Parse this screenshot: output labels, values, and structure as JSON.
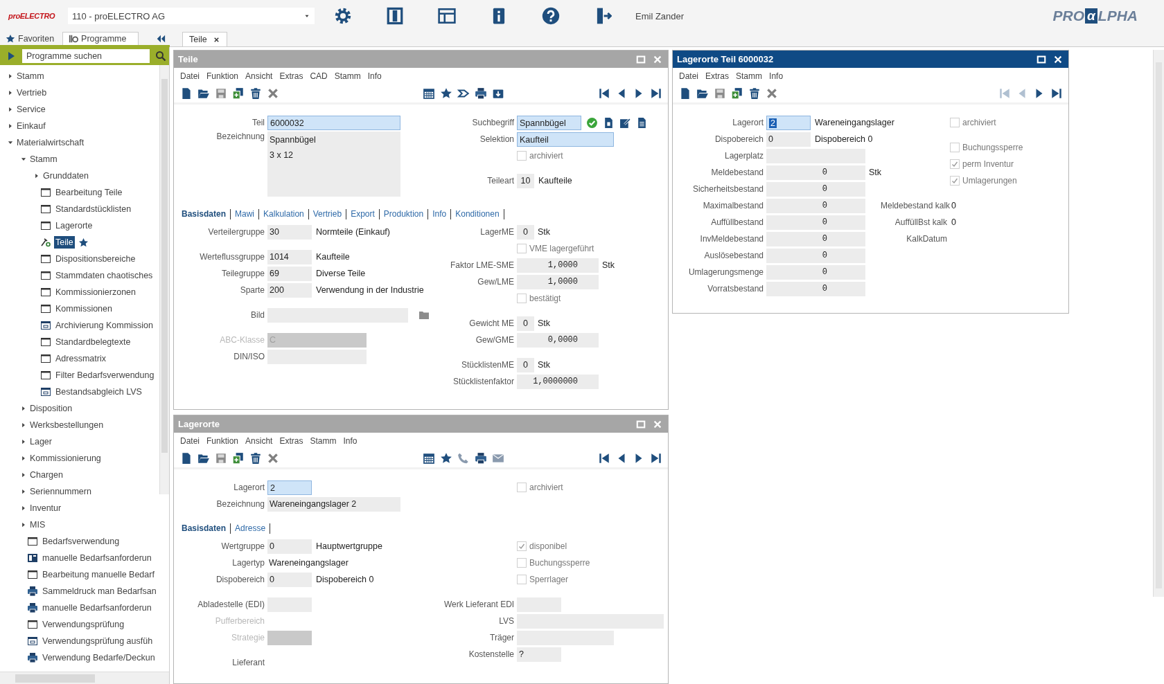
{
  "top_bar": {
    "logo": "proELECTRO",
    "company": "110 - proELECTRO AG",
    "user": "Emil Zander",
    "vendor_logo": [
      "PRO",
      "α",
      "LPHA"
    ]
  },
  "sidebar": {
    "tabs": [
      {
        "label": "Favoriten",
        "selected": false
      },
      {
        "label": "Programme",
        "selected": true
      }
    ],
    "search": {
      "placeholder": "Programme suchen"
    },
    "tree": [
      {
        "label": "Stamm",
        "kind": "group",
        "expanded": false,
        "selected": false
      },
      {
        "label": "Vertrieb",
        "kind": "group",
        "expanded": false,
        "selected": false
      },
      {
        "label": "Service",
        "kind": "group",
        "expanded": false,
        "selected": false
      },
      {
        "label": "Einkauf",
        "kind": "group",
        "expanded": false,
        "selected": false
      },
      {
        "label": "Materialwirtschaft",
        "kind": "group",
        "expanded": true,
        "selected": false,
        "children": [
          {
            "label": "Stamm",
            "kind": "group",
            "expanded": true,
            "selected": false,
            "children": [
              {
                "label": "Grunddaten",
                "kind": "group",
                "expanded": false,
                "selected": false
              },
              {
                "label": "Bearbeitung Teile",
                "kind": "window",
                "selected": false
              },
              {
                "label": "Standardstücklisten",
                "kind": "window",
                "selected": false
              },
              {
                "label": "Lagerorte",
                "kind": "window",
                "selected": false
              },
              {
                "label": "Teile",
                "kind": "tool",
                "selected": true
              },
              {
                "label": "Dispositionsbereiche",
                "kind": "window",
                "selected": false
              },
              {
                "label": "Stammdaten chaotisches",
                "kind": "window",
                "selected": false
              },
              {
                "label": "Kommissionierzonen",
                "kind": "window",
                "selected": false
              },
              {
                "label": "Kommissionen",
                "kind": "window",
                "selected": false
              },
              {
                "label": "Archivierung Kommission",
                "kind": "action",
                "selected": false
              },
              {
                "label": "Standardbelegtexte",
                "kind": "window",
                "selected": false
              },
              {
                "label": "Adressmatrix",
                "kind": "window",
                "selected": false
              },
              {
                "label": "Filter Bedarfsverwendung",
                "kind": "window",
                "selected": false
              },
              {
                "label": "Bestandsabgleich LVS",
                "kind": "action",
                "selected": false
              }
            ]
          },
          {
            "label": "Disposition",
            "kind": "group",
            "expanded": false,
            "selected": false
          },
          {
            "label": "Werksbestellungen",
            "kind": "group",
            "expanded": false,
            "selected": false
          },
          {
            "label": "Lager",
            "kind": "group",
            "expanded": false,
            "selected": false
          },
          {
            "label": "Kommissionierung",
            "kind": "group",
            "expanded": false,
            "selected": false
          },
          {
            "label": "Chargen",
            "kind": "group",
            "expanded": false,
            "selected": false
          },
          {
            "label": "Seriennummern",
            "kind": "group",
            "expanded": false,
            "selected": false
          },
          {
            "label": "Inventur",
            "kind": "group",
            "expanded": false,
            "selected": false
          },
          {
            "label": "MIS",
            "kind": "group",
            "expanded": false,
            "selected": false
          },
          {
            "label": "Bedarfsverwendung",
            "kind": "window",
            "selected": false
          },
          {
            "label": "manuelle Bedarfsanforderun",
            "kind": "sheet",
            "selected": false
          },
          {
            "label": "Bearbeitung manuelle Bedarf",
            "kind": "window",
            "selected": false
          },
          {
            "label": "Sammeldruck man Bedarfsan",
            "kind": "print",
            "selected": false
          },
          {
            "label": "manuelle Bedarfsanforderun",
            "kind": "print",
            "selected": false
          },
          {
            "label": "Verwendungsprüfung",
            "kind": "window",
            "selected": false
          },
          {
            "label": "Verwendungsprüfung ausfüh",
            "kind": "action",
            "selected": false
          },
          {
            "label": "Verwendung Bedarfe/Deckun",
            "kind": "print",
            "selected": false
          }
        ]
      }
    ]
  },
  "document_tabs": [
    {
      "label": "Teile",
      "selected": true
    }
  ],
  "panels": [
    {
      "title": "Teile",
      "active": false,
      "menu": [
        "Datei",
        "Funktion",
        "Ansicht",
        "Extras",
        "CAD",
        "Stamm",
        "Info"
      ],
      "toolbar": {
        "left": [
          {
            "kind": "new"
          },
          {
            "kind": "open"
          },
          {
            "kind": "save"
          },
          {
            "kind": "copy"
          },
          {
            "kind": "delete"
          },
          {
            "kind": "cancel"
          }
        ],
        "middle": [
          {
            "kind": "calendar"
          },
          {
            "kind": "star"
          },
          {
            "kind": "link"
          },
          {
            "kind": "print"
          },
          {
            "kind": "export"
          }
        ],
        "right": [
          {
            "kind": "first",
            "disabled": false
          },
          {
            "kind": "prev",
            "disabled": false
          },
          {
            "kind": "next",
            "disabled": false
          },
          {
            "kind": "last",
            "disabled": false
          }
        ]
      },
      "header": {
        "left": [
          [
            {
              "kind": "text",
              "label": "Teil",
              "value": "6000032",
              "key": true
            },
            {
              "kind": "memo",
              "label": "Bezeichnung",
              "lines": [
                "Spannbügel",
                "3 x 12"
              ],
              "key": false
            }
          ]
        ],
        "right": [
          [
            {
              "kind": "text",
              "label": "Suchbegriff",
              "value": "Spannbügel",
              "key": true,
              "actions": [
                {
                  "kind": "ok"
                },
                {
                  "kind": "doc"
                },
                {
                  "kind": "edit"
                },
                {
                  "kind": "list"
                }
              ]
            },
            {
              "kind": "text",
              "label": "Selektion",
              "value": "Kaufteil",
              "key": true
            },
            {
              "kind": "check",
              "label": "archiviert",
              "checked": false
            }
          ],
          [
            {
              "kind": "qty",
              "label": "Teileart",
              "value": "10",
              "text": "Kaufteile",
              "key": false
            }
          ]
        ]
      },
      "tabs": [
        {
          "label": "Basisdaten",
          "selected": true
        },
        {
          "label": "Mawi",
          "selected": false
        },
        {
          "label": "Kalkulation",
          "selected": false
        },
        {
          "label": "Vertrieb",
          "selected": false
        },
        {
          "label": "Export",
          "selected": false
        },
        {
          "label": "Produktion",
          "selected": false
        },
        {
          "label": "Info",
          "selected": false
        },
        {
          "label": "Konditionen",
          "selected": false
        }
      ],
      "body": {
        "left": [
          [
            {
              "kind": "code",
              "label": "Verteilergruppe",
              "value": "30",
              "text": "Normteile (Einkauf)",
              "key": false
            }
          ],
          [
            {
              "kind": "code",
              "label": "Werteflussgruppe",
              "value": "1014",
              "text": "Kaufteile",
              "key": false
            },
            {
              "kind": "code",
              "label": "Teilegruppe",
              "value": "69",
              "text": "Diverse Teile",
              "key": false
            },
            {
              "kind": "code",
              "label": "Sparte",
              "value": "200",
              "text": "Verwendung in der Industrie",
              "key": false
            }
          ],
          [
            {
              "kind": "wide",
              "label": "Bild",
              "key": false,
              "browse": true
            }
          ],
          [
            {
              "kind": "medium",
              "label": "ABC-Klasse",
              "value": "C",
              "key": false,
              "disabled": true
            },
            {
              "kind": "medium",
              "label": "DIN/ISO",
              "key": false
            }
          ]
        ],
        "right": [
          [
            {
              "kind": "qty",
              "label": "LagerME",
              "value": "0",
              "unit": "Stk",
              "key": false
            },
            {
              "kind": "check",
              "label": "VME lagergeführt",
              "checked": false
            },
            {
              "kind": "number",
              "label": "Faktor LME-SME",
              "value": "1,0000",
              "unit": "Stk",
              "key": false
            },
            {
              "kind": "number",
              "label": "Gew/LME",
              "value": "1,0000",
              "key": false
            },
            {
              "kind": "check",
              "label": "bestätigt",
              "checked": false
            }
          ],
          [
            {
              "kind": "qty",
              "label": "Gewicht ME",
              "value": "0",
              "unit": "Stk",
              "key": false
            },
            {
              "kind": "number",
              "label": "Gew/GME",
              "value": "0,0000",
              "key": false
            }
          ],
          [
            {
              "kind": "qty",
              "label": "StücklistenME",
              "value": "0",
              "unit": "Stk",
              "key": false
            },
            {
              "kind": "number",
              "label": "Stücklistenfaktor",
              "value": "1,0000000",
              "key": false
            }
          ]
        ]
      }
    },
    {
      "title": "Lagerorte",
      "active": false,
      "menu": [
        "Datei",
        "Funktion",
        "Ansicht",
        "Extras",
        "Stamm",
        "Info"
      ],
      "toolbar": {
        "left": [
          {
            "kind": "new"
          },
          {
            "kind": "open"
          },
          {
            "kind": "save"
          },
          {
            "kind": "copy"
          },
          {
            "kind": "delete"
          },
          {
            "kind": "cancel"
          }
        ],
        "middle": [
          {
            "kind": "calendar"
          },
          {
            "kind": "star"
          },
          {
            "kind": "phone"
          },
          {
            "kind": "print"
          },
          {
            "kind": "mail"
          }
        ],
        "right": [
          {
            "kind": "first",
            "disabled": false
          },
          {
            "kind": "prev",
            "disabled": false
          },
          {
            "kind": "next",
            "disabled": false
          },
          {
            "kind": "last",
            "disabled": false
          }
        ]
      },
      "header": {
        "left": [
          [
            {
              "kind": "code",
              "label": "Lagerort",
              "value": "2",
              "key": true
            },
            {
              "kind": "text",
              "label": "Bezeichnung",
              "value": "Wareneingangslager 2",
              "key": false
            }
          ]
        ],
        "right": [
          [
            {
              "kind": "check",
              "label": "archiviert",
              "checked": false
            }
          ]
        ]
      },
      "tabs": [
        {
          "label": "Basisdaten",
          "selected": true
        },
        {
          "label": "Adresse",
          "selected": false
        }
      ],
      "body": {
        "left": [
          [
            {
              "kind": "code",
              "label": "Wertgruppe",
              "value": "0",
              "text": "Hauptwertgruppe",
              "key": false
            },
            {
              "kind": "plain",
              "label": "Lagertyp",
              "value": "Wareneingangslager"
            },
            {
              "kind": "code",
              "label": "Dispobereich",
              "value": "0",
              "text": "Dispobereich 0",
              "key": false
            }
          ],
          [
            {
              "kind": "code",
              "label": "Abladestelle (EDI)",
              "key": false
            },
            {
              "kind": "label",
              "label": "Pufferbereich",
              "disabled": true
            },
            {
              "kind": "code",
              "label": "Strategie",
              "key": false,
              "disabled": true
            }
          ],
          [
            {
              "kind": "label",
              "label": "Lieferant"
            }
          ]
        ],
        "right": [
          [
            {
              "kind": "check",
              "label": "disponibel",
              "checked": true
            },
            {
              "kind": "check",
              "label": "Buchungssperre",
              "checked": false
            },
            {
              "kind": "check",
              "label": "Sperrlager",
              "checked": false
            }
          ],
          [
            {
              "kind": "code",
              "label": "Werk Lieferant EDI",
              "key": false
            },
            {
              "kind": "wide",
              "label": "LVS",
              "key": false
            },
            {
              "kind": "text",
              "label": "Träger",
              "key": false
            },
            {
              "kind": "code",
              "label": "Kostenstelle",
              "value": "?",
              "key": false
            }
          ]
        ]
      }
    },
    {
      "title": "Lagerorte Teil 6000032",
      "active": true,
      "menu": [
        "Datei",
        "Extras",
        "Stamm",
        "Info"
      ],
      "toolbar": {
        "left": [
          {
            "kind": "new"
          },
          {
            "kind": "open"
          },
          {
            "kind": "save"
          },
          {
            "kind": "copy"
          },
          {
            "kind": "delete"
          },
          {
            "kind": "cancel"
          }
        ],
        "right": [
          {
            "kind": "first",
            "disabled": true
          },
          {
            "kind": "prev",
            "disabled": true
          },
          {
            "kind": "next",
            "disabled": false
          },
          {
            "kind": "last",
            "disabled": false
          }
        ]
      },
      "header": {
        "left": [
          [
            {
              "kind": "code",
              "label": "Lagerort",
              "value": "2",
              "text": "Wareneingangslager",
              "key": true,
              "text_selected": true
            },
            {
              "kind": "code",
              "label": "Dispobereich",
              "value": "0",
              "text": "Dispobereich 0",
              "key": false
            },
            {
              "kind": "number",
              "label": "Lagerplatz",
              "key": false
            },
            {
              "kind": "number",
              "label": "Meldebestand",
              "value": "0",
              "unit": "Stk",
              "key": false
            },
            {
              "kind": "number",
              "label": "Sicherheitsbestand",
              "value": "0",
              "key": false
            },
            {
              "kind": "number",
              "label": "Maximalbestand",
              "value": "0",
              "key": false
            },
            {
              "kind": "number",
              "label": "Auffüllbestand",
              "value": "0",
              "key": false
            },
            {
              "kind": "number",
              "label": "InvMeldebestand",
              "value": "0",
              "key": false
            },
            {
              "kind": "number",
              "label": "Auslösebestand",
              "value": "0",
              "key": false
            },
            {
              "kind": "number",
              "label": "Umlagerungsmenge",
              "value": "0",
              "key": false
            },
            {
              "kind": "number",
              "label": "Vorratsbestand",
              "value": "0",
              "key": false
            }
          ]
        ],
        "right": [
          [
            {
              "kind": "check",
              "label": "archiviert",
              "checked": false
            }
          ],
          [
            {
              "kind": "check",
              "label": "Buchungssperre",
              "checked": false
            },
            {
              "kind": "check",
              "label": "perm Inventur",
              "checked": true
            },
            {
              "kind": "check",
              "label": "Umlagerungen",
              "checked": true
            }
          ],
          [
            {
              "kind": "plain",
              "label": "Meldebestand kalk",
              "value": "0"
            },
            {
              "kind": "plain",
              "label": "AuffüllBst kalk",
              "value": "0"
            },
            {
              "kind": "label",
              "label": "KalkDatum"
            }
          ]
        ]
      }
    }
  ]
}
